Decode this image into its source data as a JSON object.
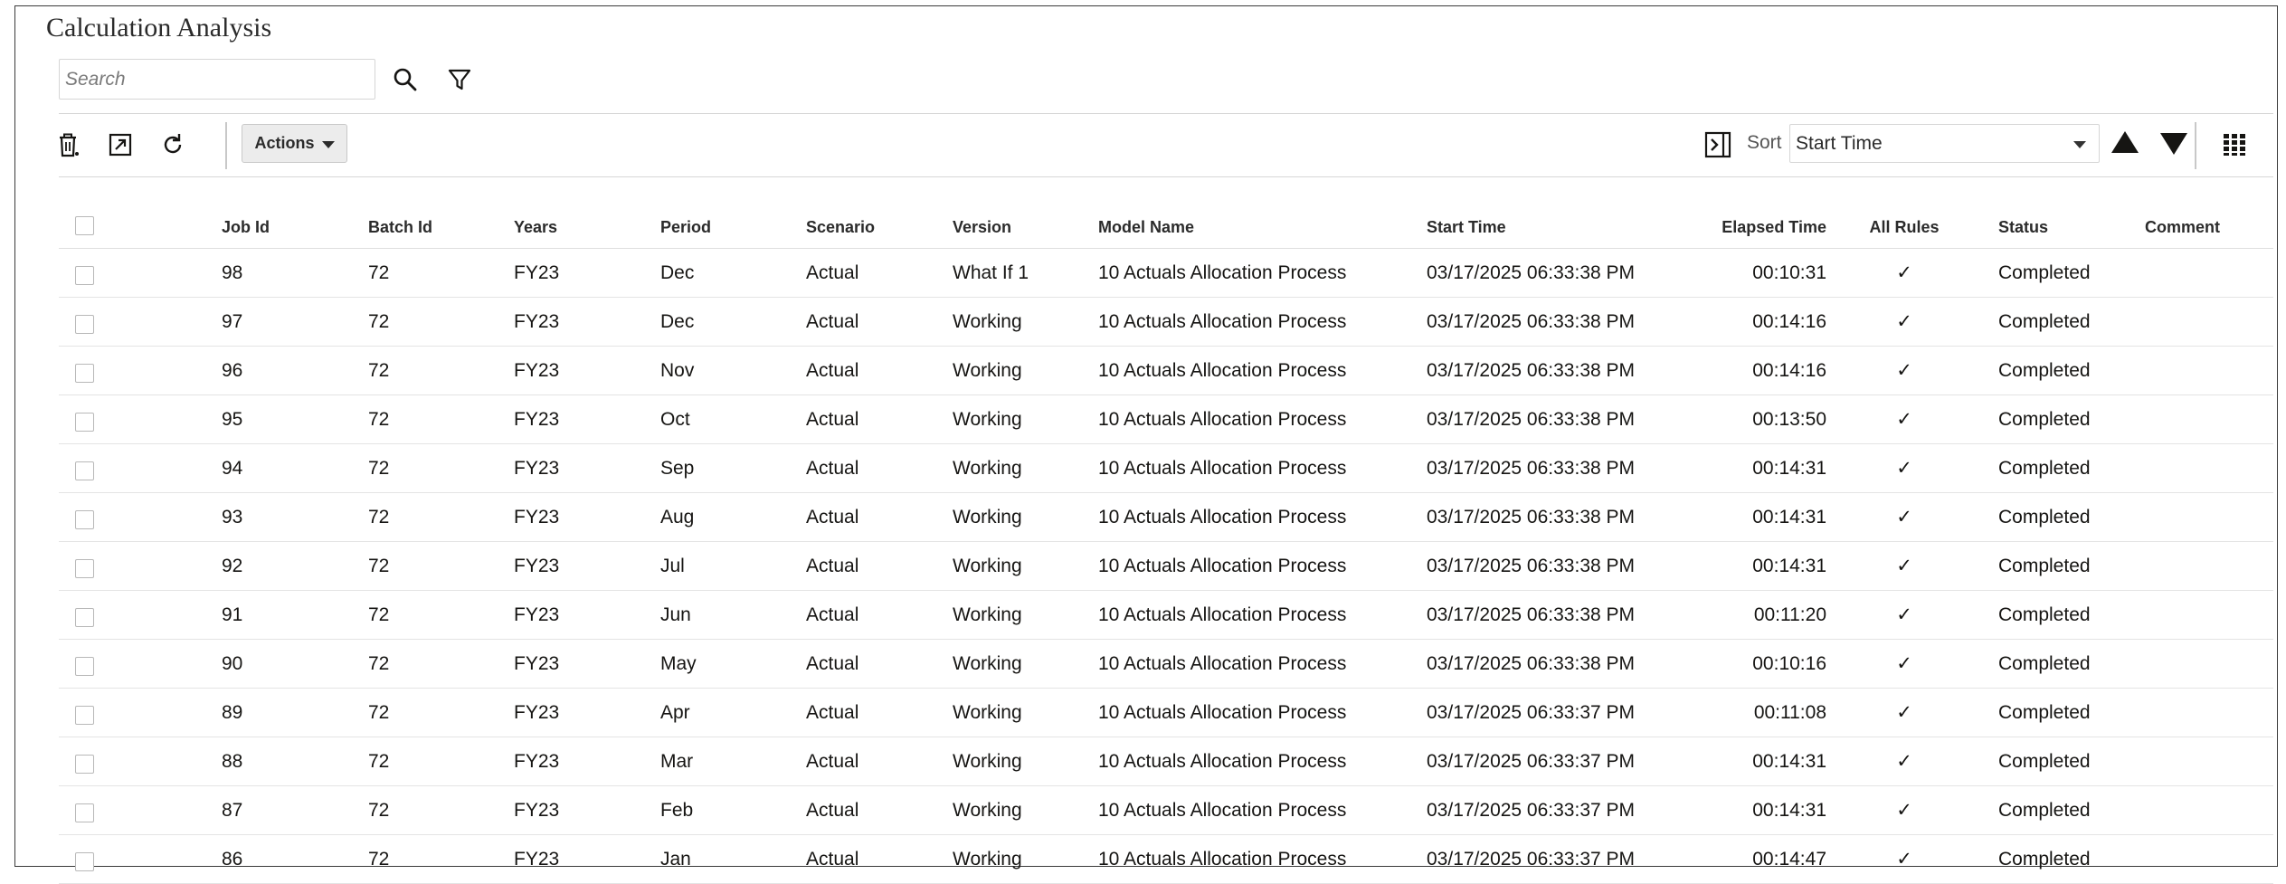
{
  "page": {
    "title": "Calculation Analysis"
  },
  "search": {
    "placeholder": "Search",
    "value": ""
  },
  "toolbar": {
    "delete_icon": "delete-icon",
    "export_icon": "export-icon",
    "refresh_icon": "refresh-icon",
    "actions_label": "Actions",
    "detach_icon": "detach-panel-icon",
    "sort_label": "Sort",
    "sort_value": "Start Time",
    "grid_icon": "grid-view-icon"
  },
  "table": {
    "columns": [
      "Job Id",
      "Batch Id",
      "Years",
      "Period",
      "Scenario",
      "Version",
      "Model Name",
      "Start Time",
      "Elapsed Time",
      "All Rules",
      "Status",
      "Comment"
    ],
    "rows": [
      {
        "job_id": "98",
        "batch_id": "72",
        "years": "FY23",
        "period": "Dec",
        "scenario": "Actual",
        "version": "What If 1",
        "model_name": "10 Actuals Allocation Process",
        "start_time": "03/17/2025 06:33:38 PM",
        "elapsed_time": "00:10:31",
        "all_rules": "✓",
        "status": "Completed",
        "comment": ""
      },
      {
        "job_id": "97",
        "batch_id": "72",
        "years": "FY23",
        "period": "Dec",
        "scenario": "Actual",
        "version": "Working",
        "model_name": "10 Actuals Allocation Process",
        "start_time": "03/17/2025 06:33:38 PM",
        "elapsed_time": "00:14:16",
        "all_rules": "✓",
        "status": "Completed",
        "comment": ""
      },
      {
        "job_id": "96",
        "batch_id": "72",
        "years": "FY23",
        "period": "Nov",
        "scenario": "Actual",
        "version": "Working",
        "model_name": "10 Actuals Allocation Process",
        "start_time": "03/17/2025 06:33:38 PM",
        "elapsed_time": "00:14:16",
        "all_rules": "✓",
        "status": "Completed",
        "comment": ""
      },
      {
        "job_id": "95",
        "batch_id": "72",
        "years": "FY23",
        "period": "Oct",
        "scenario": "Actual",
        "version": "Working",
        "model_name": "10 Actuals Allocation Process",
        "start_time": "03/17/2025 06:33:38 PM",
        "elapsed_time": "00:13:50",
        "all_rules": "✓",
        "status": "Completed",
        "comment": ""
      },
      {
        "job_id": "94",
        "batch_id": "72",
        "years": "FY23",
        "period": "Sep",
        "scenario": "Actual",
        "version": "Working",
        "model_name": "10 Actuals Allocation Process",
        "start_time": "03/17/2025 06:33:38 PM",
        "elapsed_time": "00:14:31",
        "all_rules": "✓",
        "status": "Completed",
        "comment": ""
      },
      {
        "job_id": "93",
        "batch_id": "72",
        "years": "FY23",
        "period": "Aug",
        "scenario": "Actual",
        "version": "Working",
        "model_name": "10 Actuals Allocation Process",
        "start_time": "03/17/2025 06:33:38 PM",
        "elapsed_time": "00:14:31",
        "all_rules": "✓",
        "status": "Completed",
        "comment": ""
      },
      {
        "job_id": "92",
        "batch_id": "72",
        "years": "FY23",
        "period": "Jul",
        "scenario": "Actual",
        "version": "Working",
        "model_name": "10 Actuals Allocation Process",
        "start_time": "03/17/2025 06:33:38 PM",
        "elapsed_time": "00:14:31",
        "all_rules": "✓",
        "status": "Completed",
        "comment": ""
      },
      {
        "job_id": "91",
        "batch_id": "72",
        "years": "FY23",
        "period": "Jun",
        "scenario": "Actual",
        "version": "Working",
        "model_name": "10 Actuals Allocation Process",
        "start_time": "03/17/2025 06:33:38 PM",
        "elapsed_time": "00:11:20",
        "all_rules": "✓",
        "status": "Completed",
        "comment": ""
      },
      {
        "job_id": "90",
        "batch_id": "72",
        "years": "FY23",
        "period": "May",
        "scenario": "Actual",
        "version": "Working",
        "model_name": "10 Actuals Allocation Process",
        "start_time": "03/17/2025 06:33:38 PM",
        "elapsed_time": "00:10:16",
        "all_rules": "✓",
        "status": "Completed",
        "comment": ""
      },
      {
        "job_id": "89",
        "batch_id": "72",
        "years": "FY23",
        "period": "Apr",
        "scenario": "Actual",
        "version": "Working",
        "model_name": "10 Actuals Allocation Process",
        "start_time": "03/17/2025 06:33:37 PM",
        "elapsed_time": "00:11:08",
        "all_rules": "✓",
        "status": "Completed",
        "comment": ""
      },
      {
        "job_id": "88",
        "batch_id": "72",
        "years": "FY23",
        "period": "Mar",
        "scenario": "Actual",
        "version": "Working",
        "model_name": "10 Actuals Allocation Process",
        "start_time": "03/17/2025 06:33:37 PM",
        "elapsed_time": "00:14:31",
        "all_rules": "✓",
        "status": "Completed",
        "comment": ""
      },
      {
        "job_id": "87",
        "batch_id": "72",
        "years": "FY23",
        "period": "Feb",
        "scenario": "Actual",
        "version": "Working",
        "model_name": "10 Actuals Allocation Process",
        "start_time": "03/17/2025 06:33:37 PM",
        "elapsed_time": "00:14:31",
        "all_rules": "✓",
        "status": "Completed",
        "comment": ""
      },
      {
        "job_id": "86",
        "batch_id": "72",
        "years": "FY23",
        "period": "Jan",
        "scenario": "Actual",
        "version": "Working",
        "model_name": "10 Actuals Allocation Process",
        "start_time": "03/17/2025 06:33:37 PM",
        "elapsed_time": "00:14:47",
        "all_rules": "✓",
        "status": "Completed",
        "comment": ""
      }
    ]
  }
}
